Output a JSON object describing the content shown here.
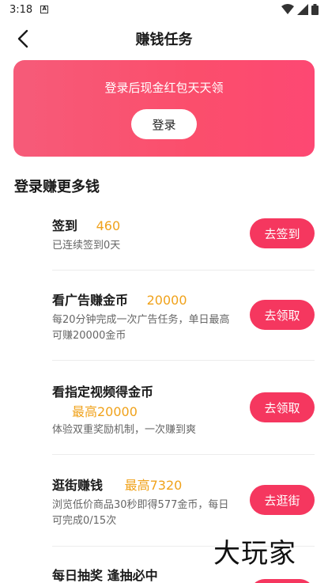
{
  "status_bar": {
    "time": "3:18",
    "notif_glyph": "A"
  },
  "nav": {
    "title": "赚钱任务"
  },
  "login_card": {
    "tip": "登录后现金红包天天领",
    "button_label": "登录"
  },
  "section": {
    "title": "登录赚更多钱"
  },
  "tasks": [
    {
      "title": "签到",
      "reward": "460",
      "desc": "已连续签到0天",
      "button": "去签到"
    },
    {
      "title": "看广告赚金币",
      "reward": "20000",
      "desc": "每20分钟完成一次广告任务，单日最高可赚20000金币",
      "button": "去领取"
    },
    {
      "title": "看指定视频得金币",
      "reward": "最高20000",
      "desc": "体验双重奖励机制，一次赚到爽",
      "button": "去领取"
    },
    {
      "title": "逛街赚钱",
      "reward": "最高7320",
      "desc": "浏览低价商品30秒即得577金币，每日可完成0/15次",
      "button": "去逛街"
    },
    {
      "title": "每日抽奖 逢抽必中",
      "reward": "",
      "desc": "",
      "button": ""
    }
  ],
  "watermark": "大玩家",
  "colors": {
    "accent": "#f5375f",
    "reward": "#f0a21b",
    "card_gradient_start": "#f65b79",
    "card_gradient_end": "#fd4873"
  }
}
